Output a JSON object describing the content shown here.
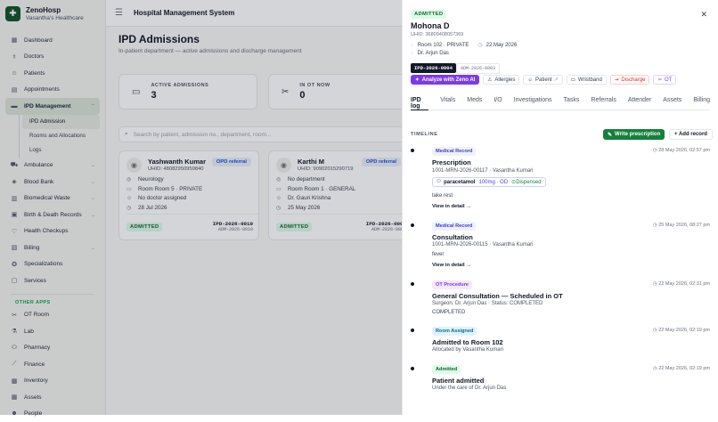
{
  "brand": {
    "name": "ZenoHosp",
    "subtitle": "Vasantha's Healthcare",
    "logo_icon": "hospital-logo-icon"
  },
  "sidebar": {
    "items": [
      {
        "label": "Dashboard",
        "icon": "grid-icon"
      },
      {
        "label": "Doctors",
        "icon": "stethoscope-icon"
      },
      {
        "label": "Patients",
        "icon": "users-icon"
      },
      {
        "label": "Appointments",
        "icon": "calendar-icon"
      },
      {
        "label": "IPD Management",
        "icon": "bed-icon"
      }
    ],
    "ipd_sub": [
      {
        "label": "IPD Admission"
      },
      {
        "label": "Rooms and Allocations"
      },
      {
        "label": "Logs"
      }
    ],
    "items2": [
      {
        "label": "Ambulance",
        "icon": "ambulance-icon"
      },
      {
        "label": "Blood Bank",
        "icon": "droplet-icon"
      },
      {
        "label": "Biomedical Waste",
        "icon": "trash-icon"
      },
      {
        "label": "Birth & Death Records",
        "icon": "records-icon"
      },
      {
        "label": "Health Checkups",
        "icon": "heart-icon"
      },
      {
        "label": "Billing",
        "icon": "receipt-icon"
      },
      {
        "label": "Specializations",
        "icon": "badge-icon"
      },
      {
        "label": "Services",
        "icon": "services-icon"
      }
    ],
    "other_apps_title": "OTHER APPS",
    "other_apps": [
      {
        "label": "OT Room",
        "icon": "scalpel-icon"
      },
      {
        "label": "Lab",
        "icon": "flask-icon"
      },
      {
        "label": "Pharmacy",
        "icon": "pill-icon"
      },
      {
        "label": "Finance",
        "icon": "chart-icon"
      },
      {
        "label": "Inventory",
        "icon": "box-icon"
      },
      {
        "label": "Assets",
        "icon": "assets-icon"
      },
      {
        "label": "People",
        "icon": "people-icon"
      }
    ]
  },
  "topbar": {
    "title": "Hospital Management System"
  },
  "page": {
    "title": "IPD Admissions",
    "subtitle": "In-patient department — active admissions and discharge management"
  },
  "stats": [
    {
      "label": "ACTIVE ADMISSIONS",
      "value": "3"
    },
    {
      "label": "IN OT NOW",
      "value": "0"
    }
  ],
  "search": {
    "placeholder": "Search by patient, admission no., department, room..."
  },
  "patients": [
    {
      "name": "Yashwanth Kumar",
      "uhid": "UHID: 48082950959840",
      "type": "OPD referral",
      "department": "Neurology",
      "room": "Room Room 5 · PRIVATE",
      "doctor": "No doctor assigned",
      "date": "28 Jul 2026",
      "status": "ADMITTED",
      "code": "IPD-2026-0010",
      "adm": "ADM-2026-0010"
    },
    {
      "name": "Karthi M",
      "uhid": "UHID: 90902015290719",
      "type": "OPD referral",
      "department": "No department",
      "room": "Room Room 1 · GENERAL",
      "doctor": "Dr. Gauri Krishna",
      "date": "25 May 2026",
      "status": "ADMITTED",
      "code": "IPD-2026-0008",
      "adm": "ADM-2026-0008"
    }
  ],
  "panel": {
    "status": "ADMITTED",
    "name": "Mohona D",
    "uhid": "UHID: 36809408057369",
    "room": "Room 102 · PRIVATE",
    "date": "22 May 2026",
    "doctor": "Dr. Arjun Das",
    "code": "IPD-2026-0004",
    "adm": "ADM-2026-0003",
    "actions": [
      "Analyze with Zeno AI",
      "Allergies",
      "Patient",
      "Wristband",
      "Discharge",
      "OT"
    ],
    "tabs": [
      "IPD log",
      "Vitals",
      "Meds",
      "I/O",
      "Investigations",
      "Tasks",
      "Referrals",
      "Attender",
      "Assets",
      "Billing"
    ],
    "timeline_title": "TIMELINE",
    "write_label": "Write prescription",
    "add_label": "+ Add record",
    "view_label": "View in detail →",
    "entries": [
      {
        "tag": "Medical Record",
        "time": "28 May 2026, 02:57 pm",
        "title": "Prescription",
        "line1": "1001-MRN-2026-00117 · Vasantha Kumari",
        "med_name": "paracetamol",
        "med_dose": "100mg · OD",
        "med_status": "Dispensed",
        "note": "take rest"
      },
      {
        "tag": "Medical Record",
        "time": "25 May 2026, 08:27 pm",
        "title": "Consultation",
        "line1": "1001-MRN-2026-00115 · Vasantha Kumari",
        "note": "fever"
      },
      {
        "tag": "OT Procedure",
        "time": "22 May 2026, 02:31 pm",
        "title": "General Consultation — Scheduled in OT",
        "line1": "Surgeon: Dr. Arjun Das · Status: COMPLETED",
        "line2": "COMPLETED"
      },
      {
        "tag": "Room Assigned",
        "time": "22 May 2026, 02:19 pm",
        "title": "Admitted to Room 102",
        "line1": "Allocated by Vasantha Kumari"
      },
      {
        "tag": "Admitted",
        "time": "22 May 2026, 02:19 pm",
        "title": "Patient admitted",
        "line1": "Under the care of Dr. Arjun Das"
      }
    ]
  }
}
